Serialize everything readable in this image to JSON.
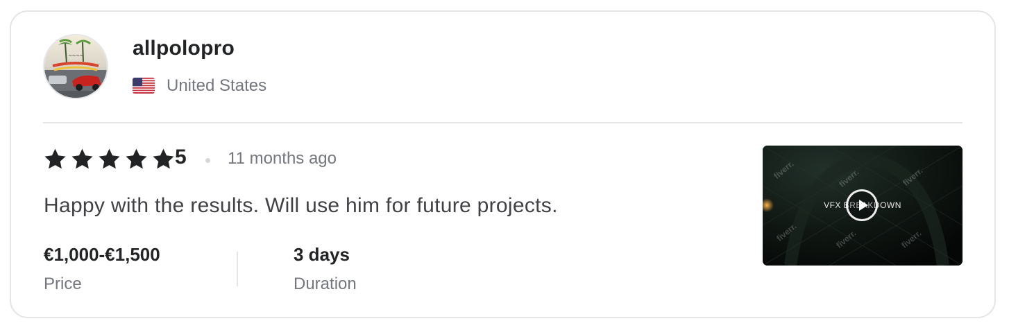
{
  "reviewer": {
    "username": "allpolopro",
    "country": "United States",
    "flag_icon": "us-flag-icon",
    "avatar_icon": "avatar-image"
  },
  "review": {
    "star_count": 5,
    "rating": "5",
    "time_ago": "11 months ago",
    "text": "Happy with the results. Will use him for future projects."
  },
  "details": {
    "price_value": "€1,000-€1,500",
    "price_label": "Price",
    "duration_value": "3 days",
    "duration_label": "Duration"
  },
  "thumbnail": {
    "title": "VFX BREAKDOWN",
    "watermark": "fiverr.",
    "play_icon": "play-icon"
  },
  "colors": {
    "text_primary": "#222325",
    "text_secondary": "#74767e",
    "border": "#e4e5e7",
    "star": "#222325"
  }
}
